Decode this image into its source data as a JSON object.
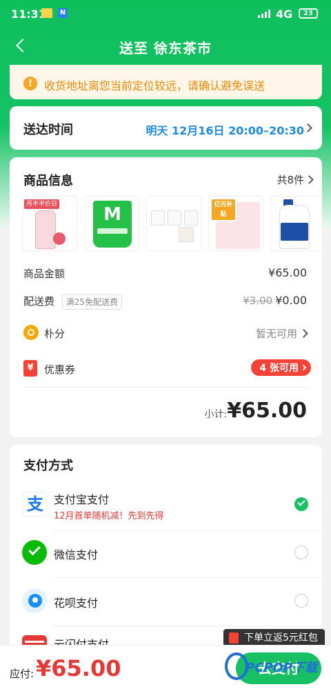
{
  "status_bar": {
    "time": "11:31",
    "network": "4G",
    "battery": "23"
  },
  "nav": {
    "title": "送至 徐东茶市"
  },
  "notice": {
    "text": "收货地址离您当前定位较远，请确认避免误送"
  },
  "delivery": {
    "label": "送达时间",
    "value": "明天 12月16日 20:00–20:30"
  },
  "goods": {
    "title": "商品信息",
    "count": "共8件",
    "thumbnails": [
      {
        "name": "yogurt-bottle-thumb",
        "badge": "月半半价日",
        "colors": [
          "#f8d9df",
          "#e85b6b"
        ]
      },
      {
        "name": "m-yogurt-cup-thumb",
        "badge": "M",
        "colors": [
          "#25c048",
          "#d8f5da"
        ]
      },
      {
        "name": "yogurt-cups-thumb",
        "badge": "",
        "colors": [
          "#ffffff",
          "#e9e9e9"
        ]
      },
      {
        "name": "yogurt-box-thumb",
        "badge": "亿元补贴",
        "colors": [
          "#fbe3e8",
          "#f5a623"
        ]
      },
      {
        "name": "milk-jug-thumb",
        "badge": "",
        "colors": [
          "#ffffff",
          "#1e4fa8"
        ]
      }
    ],
    "amount_label": "商品金额",
    "amount_value": "¥65.00",
    "shipping_label": "配送费",
    "shipping_tag": "满25免配送费",
    "shipping_original": "¥3.00",
    "shipping_value": "¥0.00",
    "points_label": "朴分",
    "points_value": "暂无可用",
    "coupon_icon": "¥",
    "coupon_label": "优惠券",
    "coupon_value": "4 张可用",
    "subtotal_label": "小计:",
    "subtotal_value": "¥65.00"
  },
  "payment": {
    "title": "支付方式",
    "methods": [
      {
        "name": "支付宝支付",
        "promo": "12月首单随机减！先到先得",
        "selected": true,
        "icon": "alipay-icon",
        "color": "#1677ff"
      },
      {
        "name": "微信支付",
        "promo": "",
        "selected": false,
        "icon": "wechat-pay-icon",
        "color": "#09bb07"
      },
      {
        "name": "花呗支付",
        "promo": "",
        "selected": false,
        "icon": "huabei-icon",
        "color": "#1890ff"
      },
      {
        "name": "云闪付支付",
        "promo": "",
        "selected": false,
        "icon": "unionpay-quickpass-icon",
        "color": "#e53935"
      }
    ]
  },
  "bottom": {
    "due_label": "应付:",
    "due_value": "¥65.00",
    "submit_label": "去支付",
    "tooltip": "下单立返5元红包"
  },
  "watermark": {
    "text": "PCPOP下载"
  },
  "colors": {
    "brand_green": "#16c063",
    "price_red": "#e53935",
    "link_blue": "#1a8ae5",
    "notice_orange": "#ee8a00"
  }
}
